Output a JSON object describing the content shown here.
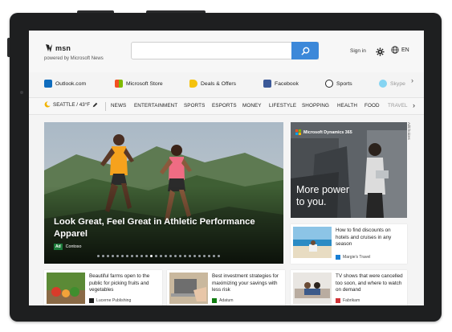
{
  "header": {
    "logo_text": "msn",
    "powered_by": "powered by Microsoft News",
    "search_placeholder": "",
    "sign_in": "Sign in",
    "language": "EN"
  },
  "quick_links": [
    {
      "label": "Outlook.com",
      "icon": "outlook-icon"
    },
    {
      "label": "Microsoft Store",
      "icon": "store-icon"
    },
    {
      "label": "Deals & Offers",
      "icon": "deals-icon"
    },
    {
      "label": "Facebook",
      "icon": "facebook-icon"
    },
    {
      "label": "Sports",
      "icon": "sports-icon"
    },
    {
      "label": "Skype",
      "icon": "skype-icon"
    }
  ],
  "weather": {
    "text": "SEATTLE / 43°F"
  },
  "categories": [
    "NEWS",
    "ENTERTAINMENT",
    "SPORTS",
    "ESPORTS",
    "MONEY",
    "LIFESTYLE",
    "SHOPPING",
    "HEALTH",
    "FOOD",
    "TRAVEL"
  ],
  "hero": {
    "title": "Look Great, Feel Great in Athletic Performance Apparel",
    "ad_label": "Ad",
    "source": "Contoso",
    "slide_count": 26,
    "active_slide": 11
  },
  "ad": {
    "brand": "Microsoft Dynamics 365",
    "headline_1": "More power",
    "headline_2": "to you.",
    "choices": "AdChoices"
  },
  "cards": [
    {
      "title": "How to find discounts on hotels and cruises in any season",
      "source": "Margie's Travel"
    },
    {
      "title": "Beautiful farms open to the public for picking fruits and vegetables",
      "source": "Lucerne Publishing"
    },
    {
      "title": "Best investment strategies for maximizing your savings with less risk",
      "source": "Adatum"
    },
    {
      "title": "TV shows that were cancelled too soon, and where to watch on demand",
      "source": "Fabrikam"
    }
  ],
  "colors": {
    "accent": "#3c88d9",
    "ad_green": "#1c7b3a",
    "frame": "#1e1f20"
  }
}
